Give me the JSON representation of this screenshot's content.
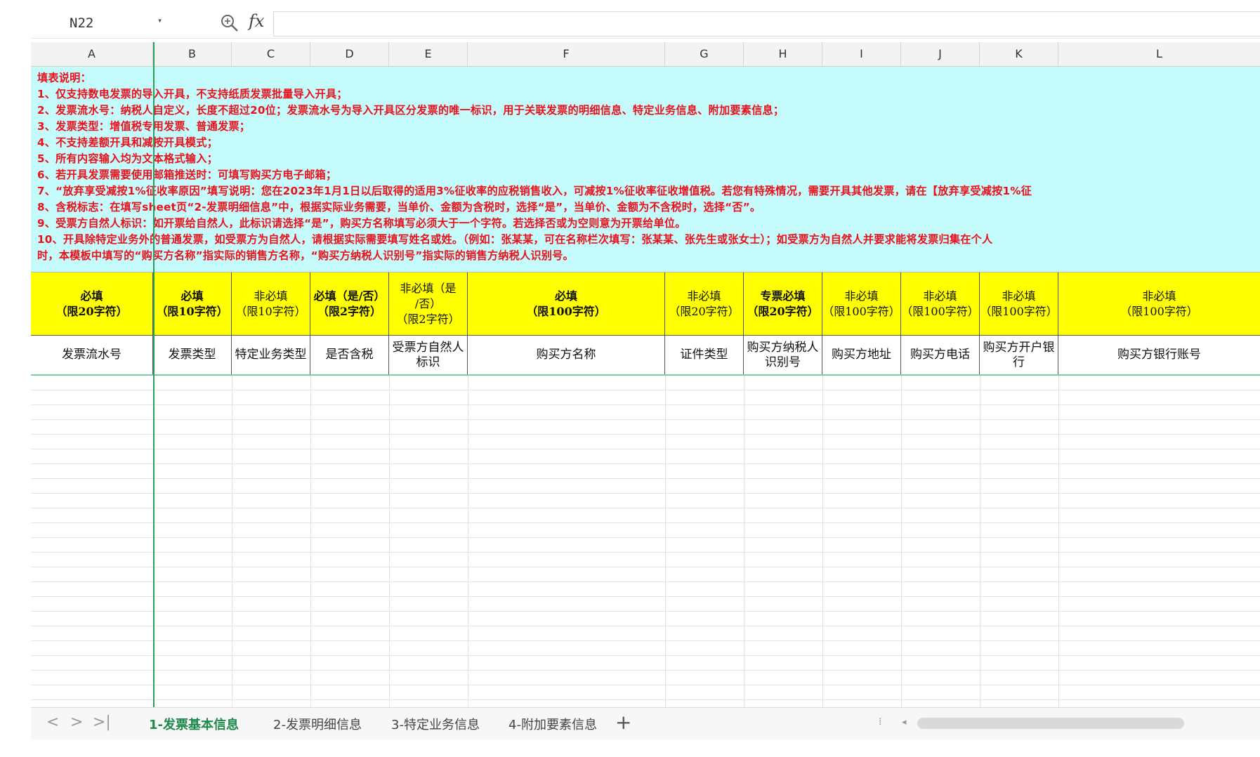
{
  "formula_bar": {
    "name_box": "N22",
    "fx_label": "fx",
    "formula": ""
  },
  "columns": [
    "A",
    "B",
    "C",
    "D",
    "E",
    "F",
    "G",
    "H",
    "I",
    "J",
    "K",
    "L"
  ],
  "instructions": [
    "填表说明：",
    "1、仅支持数电发票的导入开具，不支持纸质发票批量导入开具；",
    "2、发票流水号：纳税人自定义，长度不超过20位；发票流水号为导入开具区分发票的唯一标识，用于关联发票的明细信息、特定业务信息、附加要素信息；",
    "3、发票类型：增值税专用发票、普通发票；",
    "4、不支持差额开具和减按开具模式；",
    "5、所有内容输入均为文本格式输入；",
    "6、若开具发票需要使用邮箱推送时：可填写购买方电子邮箱；",
    "7、“放弃享受减按1%征收率原因”填写说明：您在2023年1月1日以后取得的适用3%征收率的应税销售收入，可减按1%征收率征收增值税。若您有特殊情况，需要开具其他发票，请在【放弃享受减按1%征",
    "8、含税标志：在填写sheet页“2-发票明细信息”中，根据实际业务需要，当单价、金额为含税时，选择“是”，当单价、金额为不含税时，选择“否”。",
    "9、受票方自然人标识：如开票给自然人，此标识请选择“是”，购买方名称填写必须大于一个字符。若选择否或为空则意为开票给单位。",
    "10、开具除特定业务外的普通发票，如受票方为自然人，请根据实际需要填写姓名或姓。（例如：张某某，可在名称栏次填写：张某某、张先生或张女士）；如受票方为自然人并要求能将发票归集在个人",
    "时，本模板中填写的“购买方名称”指实际的销售方名称，“购买方纳税人识别号”指实际的销售方纳税人识别号。"
  ],
  "requirement_row": [
    {
      "l1": "必填",
      "l2": "（限20字符）",
      "l3": "",
      "bold": true
    },
    {
      "l1": "必填",
      "l2": "（限10字符）",
      "l3": "",
      "bold": true
    },
    {
      "l1": "非必填",
      "l2": "（限10字符）",
      "l3": "",
      "bold": false
    },
    {
      "l1": "必填（是/否）",
      "l2": "（限2字符）",
      "l3": "",
      "bold": true
    },
    {
      "l1": "非必填（是",
      "l2": "/否）",
      "l3": "（限2字符）",
      "bold": false
    },
    {
      "l1": "必填",
      "l2": "（限100字符）",
      "l3": "",
      "bold": true
    },
    {
      "l1": "非必填",
      "l2": "（限20字符）",
      "l3": "",
      "bold": false
    },
    {
      "l1": "专票必填",
      "l2": "（限20字符）",
      "l3": "",
      "bold": true
    },
    {
      "l1": "非必填",
      "l2": "（限100字符）",
      "l3": "",
      "bold": false
    },
    {
      "l1": "非必填",
      "l2": "（限100字符）",
      "l3": "",
      "bold": false
    },
    {
      "l1": "非必填",
      "l2": "（限100字符）",
      "l3": "",
      "bold": false
    },
    {
      "l1": "非必填",
      "l2": "（限100字符）",
      "l3": "",
      "bold": false
    }
  ],
  "field_row": [
    "发票流水号",
    "发票类型",
    "特定业务类型",
    "是否含税",
    "受票方自然人标识",
    "购买方名称",
    "证件类型",
    "购买方纳税人识别号",
    "购买方地址",
    "购买方电话",
    "购买方开户银行",
    "购买方银行账号"
  ],
  "sheet_tabs": {
    "nav": [
      "<",
      ">",
      ">|"
    ],
    "tabs": [
      "1-发票基本信息",
      "2-发票明细信息",
      "3-特定业务信息",
      "4-附加要素信息"
    ],
    "active_index": 0,
    "add": "+"
  },
  "colors": {
    "instruction_bg": "#c6fbfb",
    "instruction_text": "#e8121d",
    "requirement_bg": "#ffff00",
    "accent": "#1f8a4c"
  }
}
